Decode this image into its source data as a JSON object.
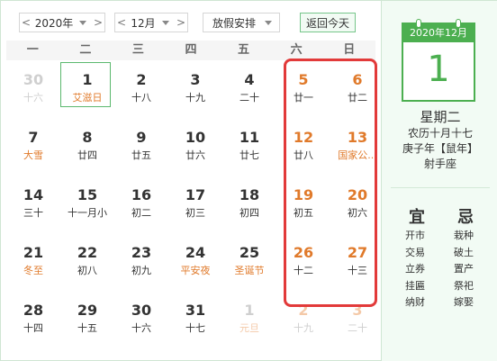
{
  "toolbar": {
    "year": "2020年",
    "month": "12月",
    "holiday": "放假安排",
    "today_button": "返回今天",
    "prev": "<",
    "next": ">"
  },
  "weekdays": [
    "一",
    "二",
    "三",
    "四",
    "五",
    "六",
    "日"
  ],
  "days": [
    {
      "d": "30",
      "s": "十六",
      "other": true,
      "wk": false,
      "fest": false
    },
    {
      "d": "1",
      "s": "艾滋日",
      "other": false,
      "wk": false,
      "fest": true,
      "sel": true
    },
    {
      "d": "2",
      "s": "十八",
      "other": false,
      "wk": false,
      "fest": false
    },
    {
      "d": "3",
      "s": "十九",
      "other": false,
      "wk": false,
      "fest": false
    },
    {
      "d": "4",
      "s": "二十",
      "other": false,
      "wk": false,
      "fest": false
    },
    {
      "d": "5",
      "s": "廿一",
      "other": false,
      "wk": true,
      "fest": false
    },
    {
      "d": "6",
      "s": "廿二",
      "other": false,
      "wk": true,
      "fest": false
    },
    {
      "d": "7",
      "s": "大雪",
      "other": false,
      "wk": false,
      "fest": true
    },
    {
      "d": "8",
      "s": "廿四",
      "other": false,
      "wk": false,
      "fest": false
    },
    {
      "d": "9",
      "s": "廿五",
      "other": false,
      "wk": false,
      "fest": false
    },
    {
      "d": "10",
      "s": "廿六",
      "other": false,
      "wk": false,
      "fest": false
    },
    {
      "d": "11",
      "s": "廿七",
      "other": false,
      "wk": false,
      "fest": false
    },
    {
      "d": "12",
      "s": "廿八",
      "other": false,
      "wk": true,
      "fest": false
    },
    {
      "d": "13",
      "s": "国家公...",
      "other": false,
      "wk": true,
      "fest": true
    },
    {
      "d": "14",
      "s": "三十",
      "other": false,
      "wk": false,
      "fest": false
    },
    {
      "d": "15",
      "s": "十一月小",
      "other": false,
      "wk": false,
      "fest": false
    },
    {
      "d": "16",
      "s": "初二",
      "other": false,
      "wk": false,
      "fest": false
    },
    {
      "d": "17",
      "s": "初三",
      "other": false,
      "wk": false,
      "fest": false
    },
    {
      "d": "18",
      "s": "初四",
      "other": false,
      "wk": false,
      "fest": false
    },
    {
      "d": "19",
      "s": "初五",
      "other": false,
      "wk": true,
      "fest": false
    },
    {
      "d": "20",
      "s": "初六",
      "other": false,
      "wk": true,
      "fest": false
    },
    {
      "d": "21",
      "s": "冬至",
      "other": false,
      "wk": false,
      "fest": true
    },
    {
      "d": "22",
      "s": "初八",
      "other": false,
      "wk": false,
      "fest": false
    },
    {
      "d": "23",
      "s": "初九",
      "other": false,
      "wk": false,
      "fest": false
    },
    {
      "d": "24",
      "s": "平安夜",
      "other": false,
      "wk": false,
      "fest": true
    },
    {
      "d": "25",
      "s": "圣诞节",
      "other": false,
      "wk": false,
      "fest": true
    },
    {
      "d": "26",
      "s": "十二",
      "other": false,
      "wk": true,
      "fest": false
    },
    {
      "d": "27",
      "s": "十三",
      "other": false,
      "wk": true,
      "fest": false
    },
    {
      "d": "28",
      "s": "十四",
      "other": false,
      "wk": false,
      "fest": false
    },
    {
      "d": "29",
      "s": "十五",
      "other": false,
      "wk": false,
      "fest": false
    },
    {
      "d": "30",
      "s": "十六",
      "other": false,
      "wk": false,
      "fest": false
    },
    {
      "d": "31",
      "s": "十七",
      "other": false,
      "wk": false,
      "fest": false
    },
    {
      "d": "1",
      "s": "元旦",
      "other": true,
      "wk": false,
      "fest": true
    },
    {
      "d": "2",
      "s": "十九",
      "other": true,
      "wk": true,
      "fest": false
    },
    {
      "d": "3",
      "s": "二十",
      "other": true,
      "wk": true,
      "fest": false
    }
  ],
  "side": {
    "page_header": "2020年12月",
    "big_day": "1",
    "weekday": "星期二",
    "lunar": "农历十月十七",
    "ganzhi": "庚子年【鼠年】",
    "star": "射手座",
    "yi_label": "宜",
    "ji_label": "忌",
    "yi_items": [
      "开市",
      "交易",
      "立券",
      "挂匾",
      "纳财"
    ],
    "ji_items": [
      "栽种",
      "破土",
      "置产",
      "祭祀",
      "嫁娶"
    ]
  },
  "colors": {
    "accent_green": "#4caf50",
    "weekend_orange": "#e07a2b",
    "highlight_red": "#e23a3a"
  }
}
